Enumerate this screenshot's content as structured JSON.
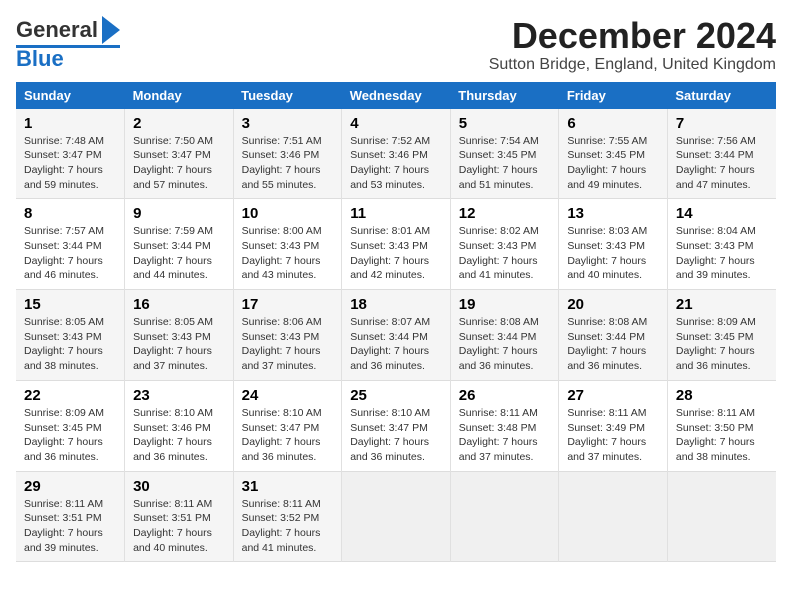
{
  "header": {
    "logo_general": "General",
    "logo_blue": "Blue",
    "title": "December 2024",
    "subtitle": "Sutton Bridge, England, United Kingdom"
  },
  "days_of_week": [
    "Sunday",
    "Monday",
    "Tuesday",
    "Wednesday",
    "Thursday",
    "Friday",
    "Saturday"
  ],
  "weeks": [
    {
      "id": "week1",
      "cells": [
        {
          "day": "1",
          "sunrise": "Sunrise: 7:48 AM",
          "sunset": "Sunset: 3:47 PM",
          "daylight": "Daylight: 7 hours and 59 minutes."
        },
        {
          "day": "2",
          "sunrise": "Sunrise: 7:50 AM",
          "sunset": "Sunset: 3:47 PM",
          "daylight": "Daylight: 7 hours and 57 minutes."
        },
        {
          "day": "3",
          "sunrise": "Sunrise: 7:51 AM",
          "sunset": "Sunset: 3:46 PM",
          "daylight": "Daylight: 7 hours and 55 minutes."
        },
        {
          "day": "4",
          "sunrise": "Sunrise: 7:52 AM",
          "sunset": "Sunset: 3:46 PM",
          "daylight": "Daylight: 7 hours and 53 minutes."
        },
        {
          "day": "5",
          "sunrise": "Sunrise: 7:54 AM",
          "sunset": "Sunset: 3:45 PM",
          "daylight": "Daylight: 7 hours and 51 minutes."
        },
        {
          "day": "6",
          "sunrise": "Sunrise: 7:55 AM",
          "sunset": "Sunset: 3:45 PM",
          "daylight": "Daylight: 7 hours and 49 minutes."
        },
        {
          "day": "7",
          "sunrise": "Sunrise: 7:56 AM",
          "sunset": "Sunset: 3:44 PM",
          "daylight": "Daylight: 7 hours and 47 minutes."
        }
      ]
    },
    {
      "id": "week2",
      "cells": [
        {
          "day": "8",
          "sunrise": "Sunrise: 7:57 AM",
          "sunset": "Sunset: 3:44 PM",
          "daylight": "Daylight: 7 hours and 46 minutes."
        },
        {
          "day": "9",
          "sunrise": "Sunrise: 7:59 AM",
          "sunset": "Sunset: 3:44 PM",
          "daylight": "Daylight: 7 hours and 44 minutes."
        },
        {
          "day": "10",
          "sunrise": "Sunrise: 8:00 AM",
          "sunset": "Sunset: 3:43 PM",
          "daylight": "Daylight: 7 hours and 43 minutes."
        },
        {
          "day": "11",
          "sunrise": "Sunrise: 8:01 AM",
          "sunset": "Sunset: 3:43 PM",
          "daylight": "Daylight: 7 hours and 42 minutes."
        },
        {
          "day": "12",
          "sunrise": "Sunrise: 8:02 AM",
          "sunset": "Sunset: 3:43 PM",
          "daylight": "Daylight: 7 hours and 41 minutes."
        },
        {
          "day": "13",
          "sunrise": "Sunrise: 8:03 AM",
          "sunset": "Sunset: 3:43 PM",
          "daylight": "Daylight: 7 hours and 40 minutes."
        },
        {
          "day": "14",
          "sunrise": "Sunrise: 8:04 AM",
          "sunset": "Sunset: 3:43 PM",
          "daylight": "Daylight: 7 hours and 39 minutes."
        }
      ]
    },
    {
      "id": "week3",
      "cells": [
        {
          "day": "15",
          "sunrise": "Sunrise: 8:05 AM",
          "sunset": "Sunset: 3:43 PM",
          "daylight": "Daylight: 7 hours and 38 minutes."
        },
        {
          "day": "16",
          "sunrise": "Sunrise: 8:05 AM",
          "sunset": "Sunset: 3:43 PM",
          "daylight": "Daylight: 7 hours and 37 minutes."
        },
        {
          "day": "17",
          "sunrise": "Sunrise: 8:06 AM",
          "sunset": "Sunset: 3:43 PM",
          "daylight": "Daylight: 7 hours and 37 minutes."
        },
        {
          "day": "18",
          "sunrise": "Sunrise: 8:07 AM",
          "sunset": "Sunset: 3:44 PM",
          "daylight": "Daylight: 7 hours and 36 minutes."
        },
        {
          "day": "19",
          "sunrise": "Sunrise: 8:08 AM",
          "sunset": "Sunset: 3:44 PM",
          "daylight": "Daylight: 7 hours and 36 minutes."
        },
        {
          "day": "20",
          "sunrise": "Sunrise: 8:08 AM",
          "sunset": "Sunset: 3:44 PM",
          "daylight": "Daylight: 7 hours and 36 minutes."
        },
        {
          "day": "21",
          "sunrise": "Sunrise: 8:09 AM",
          "sunset": "Sunset: 3:45 PM",
          "daylight": "Daylight: 7 hours and 36 minutes."
        }
      ]
    },
    {
      "id": "week4",
      "cells": [
        {
          "day": "22",
          "sunrise": "Sunrise: 8:09 AM",
          "sunset": "Sunset: 3:45 PM",
          "daylight": "Daylight: 7 hours and 36 minutes."
        },
        {
          "day": "23",
          "sunrise": "Sunrise: 8:10 AM",
          "sunset": "Sunset: 3:46 PM",
          "daylight": "Daylight: 7 hours and 36 minutes."
        },
        {
          "day": "24",
          "sunrise": "Sunrise: 8:10 AM",
          "sunset": "Sunset: 3:47 PM",
          "daylight": "Daylight: 7 hours and 36 minutes."
        },
        {
          "day": "25",
          "sunrise": "Sunrise: 8:10 AM",
          "sunset": "Sunset: 3:47 PM",
          "daylight": "Daylight: 7 hours and 36 minutes."
        },
        {
          "day": "26",
          "sunrise": "Sunrise: 8:11 AM",
          "sunset": "Sunset: 3:48 PM",
          "daylight": "Daylight: 7 hours and 37 minutes."
        },
        {
          "day": "27",
          "sunrise": "Sunrise: 8:11 AM",
          "sunset": "Sunset: 3:49 PM",
          "daylight": "Daylight: 7 hours and 37 minutes."
        },
        {
          "day": "28",
          "sunrise": "Sunrise: 8:11 AM",
          "sunset": "Sunset: 3:50 PM",
          "daylight": "Daylight: 7 hours and 38 minutes."
        }
      ]
    },
    {
      "id": "week5",
      "cells": [
        {
          "day": "29",
          "sunrise": "Sunrise: 8:11 AM",
          "sunset": "Sunset: 3:51 PM",
          "daylight": "Daylight: 7 hours and 39 minutes."
        },
        {
          "day": "30",
          "sunrise": "Sunrise: 8:11 AM",
          "sunset": "Sunset: 3:51 PM",
          "daylight": "Daylight: 7 hours and 40 minutes."
        },
        {
          "day": "31",
          "sunrise": "Sunrise: 8:11 AM",
          "sunset": "Sunset: 3:52 PM",
          "daylight": "Daylight: 7 hours and 41 minutes."
        },
        {
          "day": "",
          "sunrise": "",
          "sunset": "",
          "daylight": ""
        },
        {
          "day": "",
          "sunrise": "",
          "sunset": "",
          "daylight": ""
        },
        {
          "day": "",
          "sunrise": "",
          "sunset": "",
          "daylight": ""
        },
        {
          "day": "",
          "sunrise": "",
          "sunset": "",
          "daylight": ""
        }
      ]
    }
  ]
}
